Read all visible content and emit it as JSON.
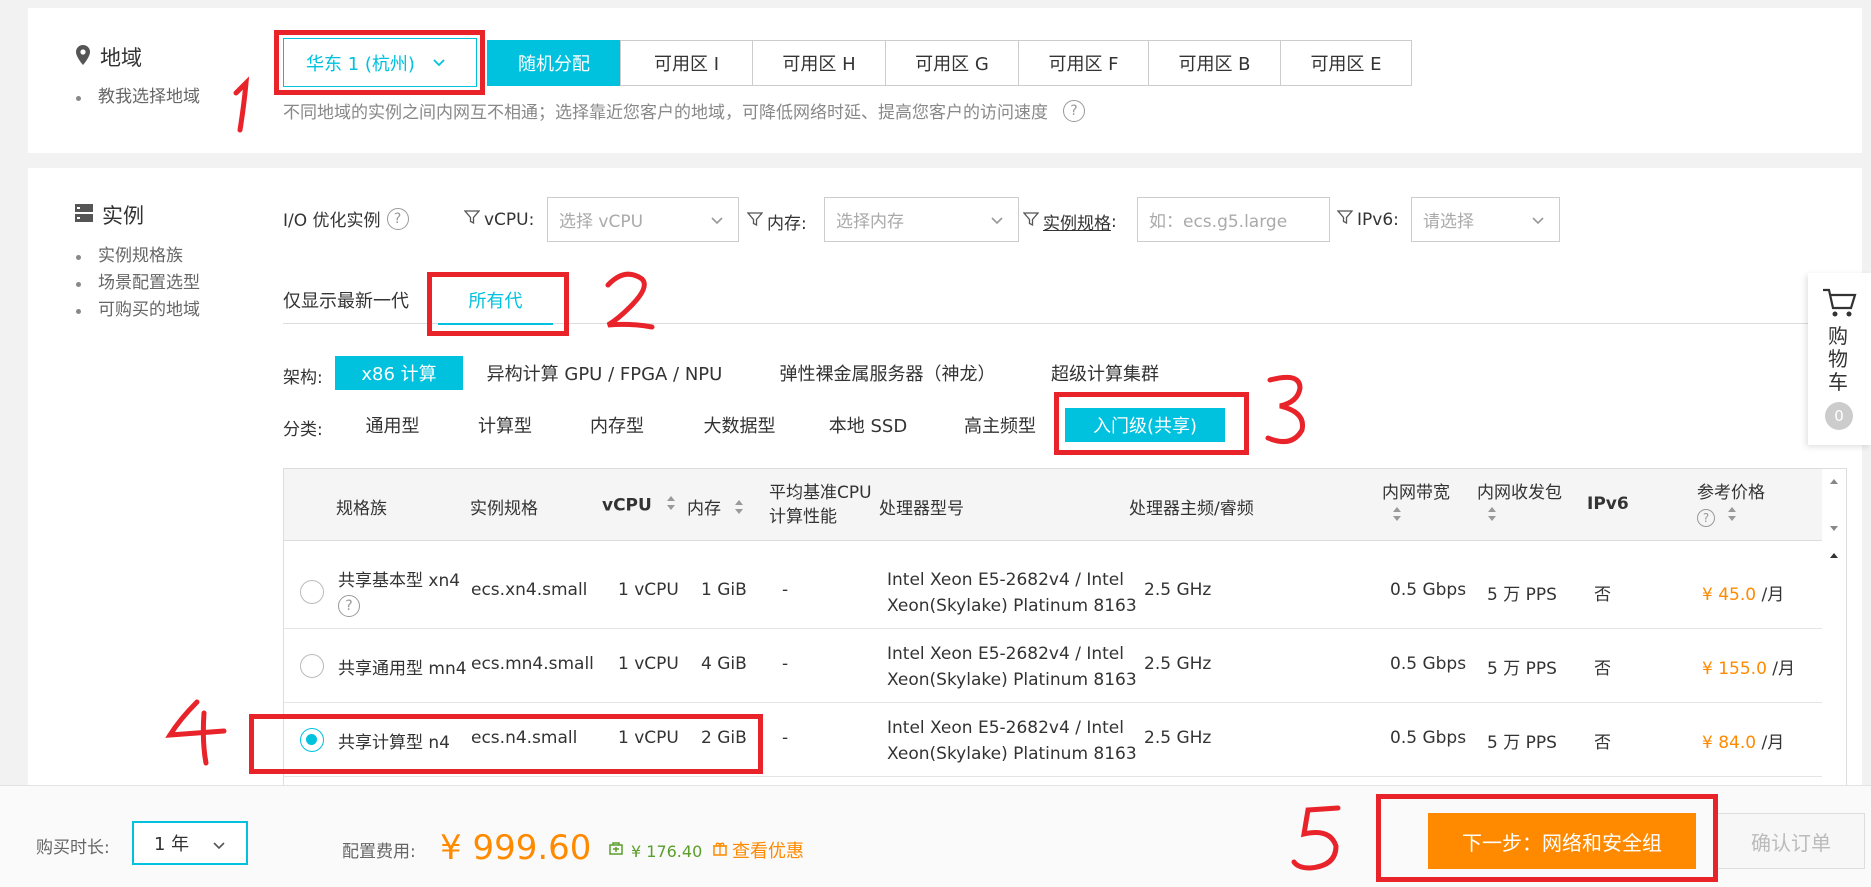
{
  "region_section": {
    "title": "地域",
    "links": [
      "教我选择地域"
    ],
    "selected_region": "华东 1 (杭州)",
    "zones": [
      "随机分配",
      "可用区 I",
      "可用区 H",
      "可用区 G",
      "可用区 F",
      "可用区 B",
      "可用区 E"
    ],
    "active_zone": "随机分配",
    "hint": "不同地域的实例之间内网互不相通；选择靠近您客户的地域，可降低网络时延、提高您客户的访问速度"
  },
  "instance_section": {
    "title": "实例",
    "links": [
      "实例规格族",
      "场景配置选型",
      "可购买的地域"
    ],
    "filters": {
      "io_label": "I/O 优化实例",
      "vcpu_label": "vCPU:",
      "vcpu_placeholder": "选择 vCPU",
      "memory_label": "内存:",
      "memory_placeholder": "选择内存",
      "spec_label": "实例规格",
      "spec_placeholder": "如：ecs.g5.large",
      "ipv6_label": "IPv6:",
      "ipv6_placeholder": "请选择"
    },
    "generation_tabs": [
      "仅显示最新一代",
      "所有代"
    ],
    "active_generation": "所有代",
    "arch_label": "架构:",
    "arch_options": [
      "x86 计算",
      "异构计算 GPU / FPGA / NPU",
      "弹性裸金属服务器（神龙）",
      "超级计算集群"
    ],
    "active_arch": "x86 计算",
    "category_label": "分类:",
    "category_options": [
      "通用型",
      "计算型",
      "内存型",
      "大数据型",
      "本地 SSD",
      "高主频型",
      "入门级(共享)"
    ],
    "active_category": "入门级(共享)"
  },
  "table": {
    "headers": {
      "family": "规格族",
      "spec": "实例规格",
      "vcpu": "vCPU",
      "memory": "内存",
      "baseline_line1": "平均基准CPU",
      "baseline_line2": "计算性能",
      "processor": "处理器型号",
      "freq": "处理器主频/睿频",
      "bandwidth": "内网带宽",
      "pps": "内网收发包",
      "ipv6": "IPv6",
      "price": "参考价格"
    },
    "rows": [
      {
        "family": "共享基本型 xn4",
        "spec": "ecs.xn4.small",
        "vcpu": "1 vCPU",
        "memory": "1 GiB",
        "baseline": "-",
        "processor_line1": "Intel Xeon E5-2682v4 / Intel",
        "processor_line2": "Xeon(Skylake) Platinum 8163",
        "freq": "2.5 GHz",
        "bandwidth": "0.5 Gbps",
        "pps": "5 万 PPS",
        "ipv6": "否",
        "price": "¥ 45.0",
        "unit": "/月",
        "selected": false
      },
      {
        "family": "共享通用型 mn4",
        "spec": "ecs.mn4.small",
        "vcpu": "1 vCPU",
        "memory": "4 GiB",
        "baseline": "-",
        "processor_line1": "Intel Xeon E5-2682v4 / Intel",
        "processor_line2": "Xeon(Skylake) Platinum 8163",
        "freq": "2.5 GHz",
        "bandwidth": "0.5 Gbps",
        "pps": "5 万 PPS",
        "ipv6": "否",
        "price": "¥ 155.0",
        "unit": "/月",
        "selected": false
      },
      {
        "family": "共享计算型 n4",
        "spec": "ecs.n4.small",
        "vcpu": "1 vCPU",
        "memory": "2 GiB",
        "baseline": "-",
        "processor_line1": "Intel Xeon E5-2682v4 / Intel",
        "processor_line2": "Xeon(Skylake) Platinum 8163",
        "freq": "2.5 GHz",
        "bandwidth": "0.5 Gbps",
        "pps": "5 万 PPS",
        "ipv6": "否",
        "price": "¥ 84.0",
        "unit": "/月",
        "selected": true
      }
    ]
  },
  "cart": {
    "label": "购物车",
    "count": "0"
  },
  "footer": {
    "duration_label": "购买时长:",
    "duration_value": "1 年",
    "fee_label": "配置费用:",
    "fee_value": "¥ 999.60",
    "savings": "¥ 176.40",
    "promo": "查看优惠",
    "next_button": "下一步：网络和安全组",
    "confirm_button": "确认订单"
  },
  "annotations": [
    "1",
    "2",
    "3",
    "4",
    "5"
  ],
  "colors": {
    "accent": "#00c1de",
    "orange": "#ff8a00",
    "annotation_red": "#e8232a"
  }
}
